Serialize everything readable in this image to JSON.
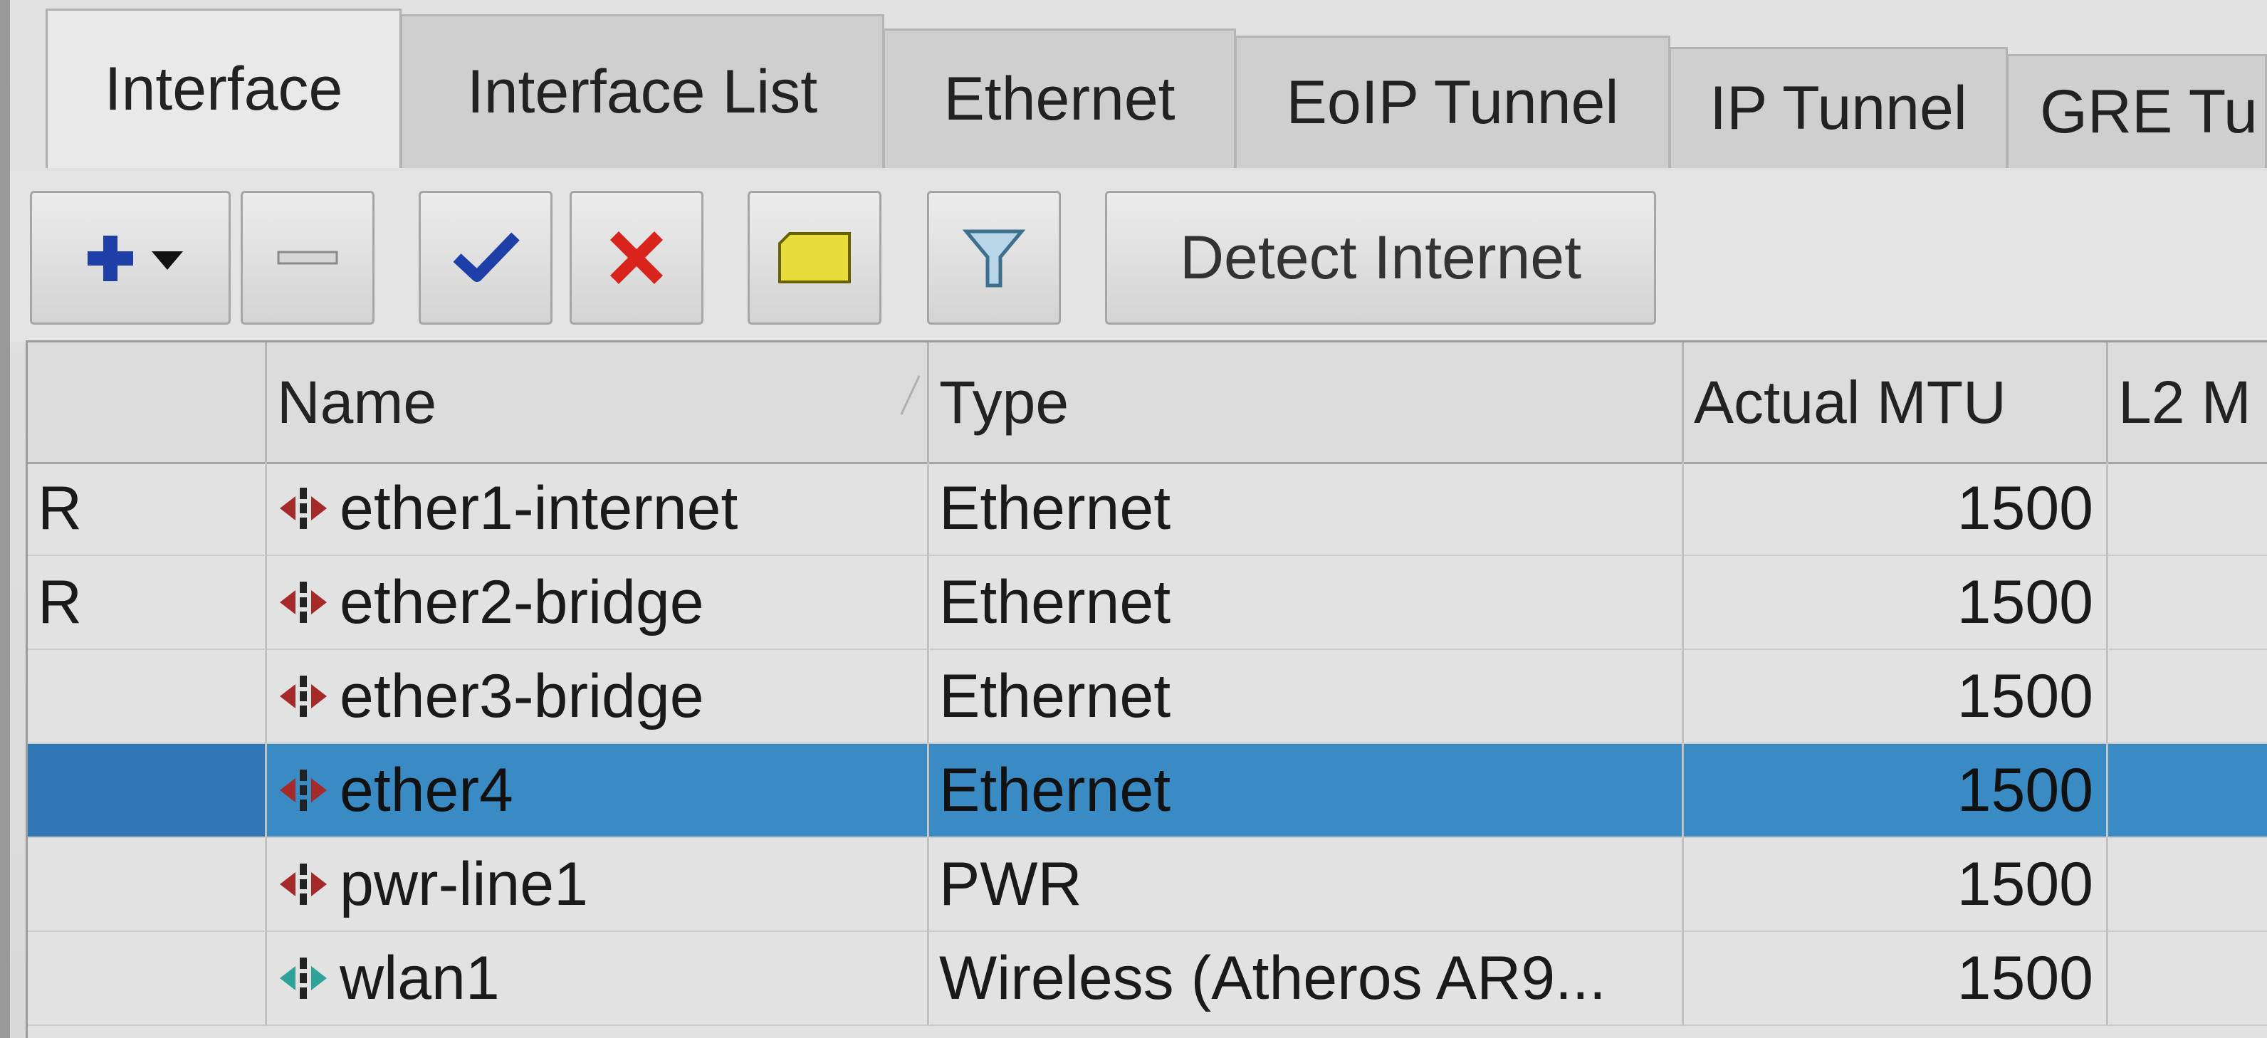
{
  "tabs": [
    {
      "label": "Interface",
      "active": true
    },
    {
      "label": "Interface List",
      "active": false
    },
    {
      "label": "Ethernet",
      "active": false
    },
    {
      "label": "EoIP Tunnel",
      "active": false
    },
    {
      "label": "IP Tunnel",
      "active": false
    },
    {
      "label": "GRE Tu",
      "active": false
    }
  ],
  "toolbar": {
    "add_icon": "plus-icon",
    "remove_icon": "minus-icon",
    "enable_icon": "checkmark-icon",
    "disable_icon": "x-icon",
    "comment_icon": "note-icon",
    "filter_icon": "filter-icon",
    "detect_internet_label": "Detect Internet"
  },
  "table": {
    "columns": [
      "",
      "Name",
      "Type",
      "Actual MTU",
      "L2 M"
    ],
    "rows": [
      {
        "flag": "R",
        "name": "ether1-internet",
        "type": "Ethernet",
        "mtu": "1500",
        "icon": "ethernet-icon",
        "selected": false
      },
      {
        "flag": "R",
        "name": "ether2-bridge",
        "type": "Ethernet",
        "mtu": "1500",
        "icon": "ethernet-icon",
        "selected": false
      },
      {
        "flag": "",
        "name": "ether3-bridge",
        "type": "Ethernet",
        "mtu": "1500",
        "icon": "ethernet-icon",
        "selected": false
      },
      {
        "flag": "",
        "name": "ether4",
        "type": "Ethernet",
        "mtu": "1500",
        "icon": "ethernet-icon",
        "selected": true
      },
      {
        "flag": "",
        "name": "pwr-line1",
        "type": "PWR",
        "mtu": "1500",
        "icon": "ethernet-icon",
        "selected": false
      },
      {
        "flag": "",
        "name": "wlan1",
        "type": "Wireless (Atheros AR9...",
        "mtu": "1500",
        "icon": "wireless-icon",
        "selected": false
      }
    ]
  },
  "colors": {
    "selected_row": "#3a8ac4",
    "add_icon": "#1f3fa8",
    "enable_icon": "#1f3fa8",
    "disable_icon": "#d8241c",
    "comment_icon": "#e8dc3a",
    "filter_icon": "#5a8fb0",
    "wireless_icon": "#2fa39a",
    "ethernet_icon": "#a52a2a"
  }
}
